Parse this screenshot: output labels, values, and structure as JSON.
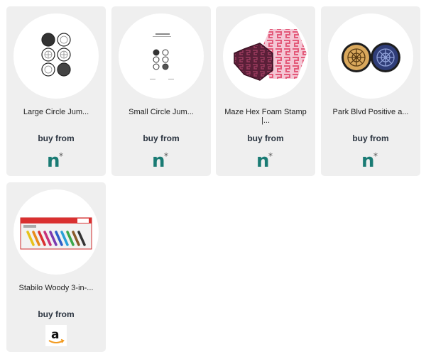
{
  "products": [
    {
      "title": "Large Circle Jum...",
      "buy_label": "buy from",
      "store_icon": "nova-n-star-icon",
      "image_icon": "large-circle-stamp-sheet-image"
    },
    {
      "title": "Small Circle Jum...",
      "buy_label": "buy from",
      "store_icon": "nova-n-star-icon",
      "image_icon": "small-circle-stamp-sheet-image"
    },
    {
      "title": "Maze Hex Foam Stamp |...",
      "buy_label": "buy from",
      "store_icon": "nova-n-star-icon",
      "image_icon": "maze-hex-stamp-image"
    },
    {
      "title": "Park Blvd Positive a...",
      "buy_label": "buy from",
      "store_icon": "nova-n-star-icon",
      "image_icon": "park-blvd-stamps-image"
    },
    {
      "title": "Stabilo Woody 3-in-...",
      "buy_label": "buy from",
      "store_icon": "amazon-icon",
      "image_icon": "stabilo-woody-box-image"
    }
  ],
  "colors": {
    "card_bg": "#efefef",
    "store_teal": "#1a7b74",
    "buy_text": "#2b3440",
    "amazon_orange": "#f29a1f"
  }
}
